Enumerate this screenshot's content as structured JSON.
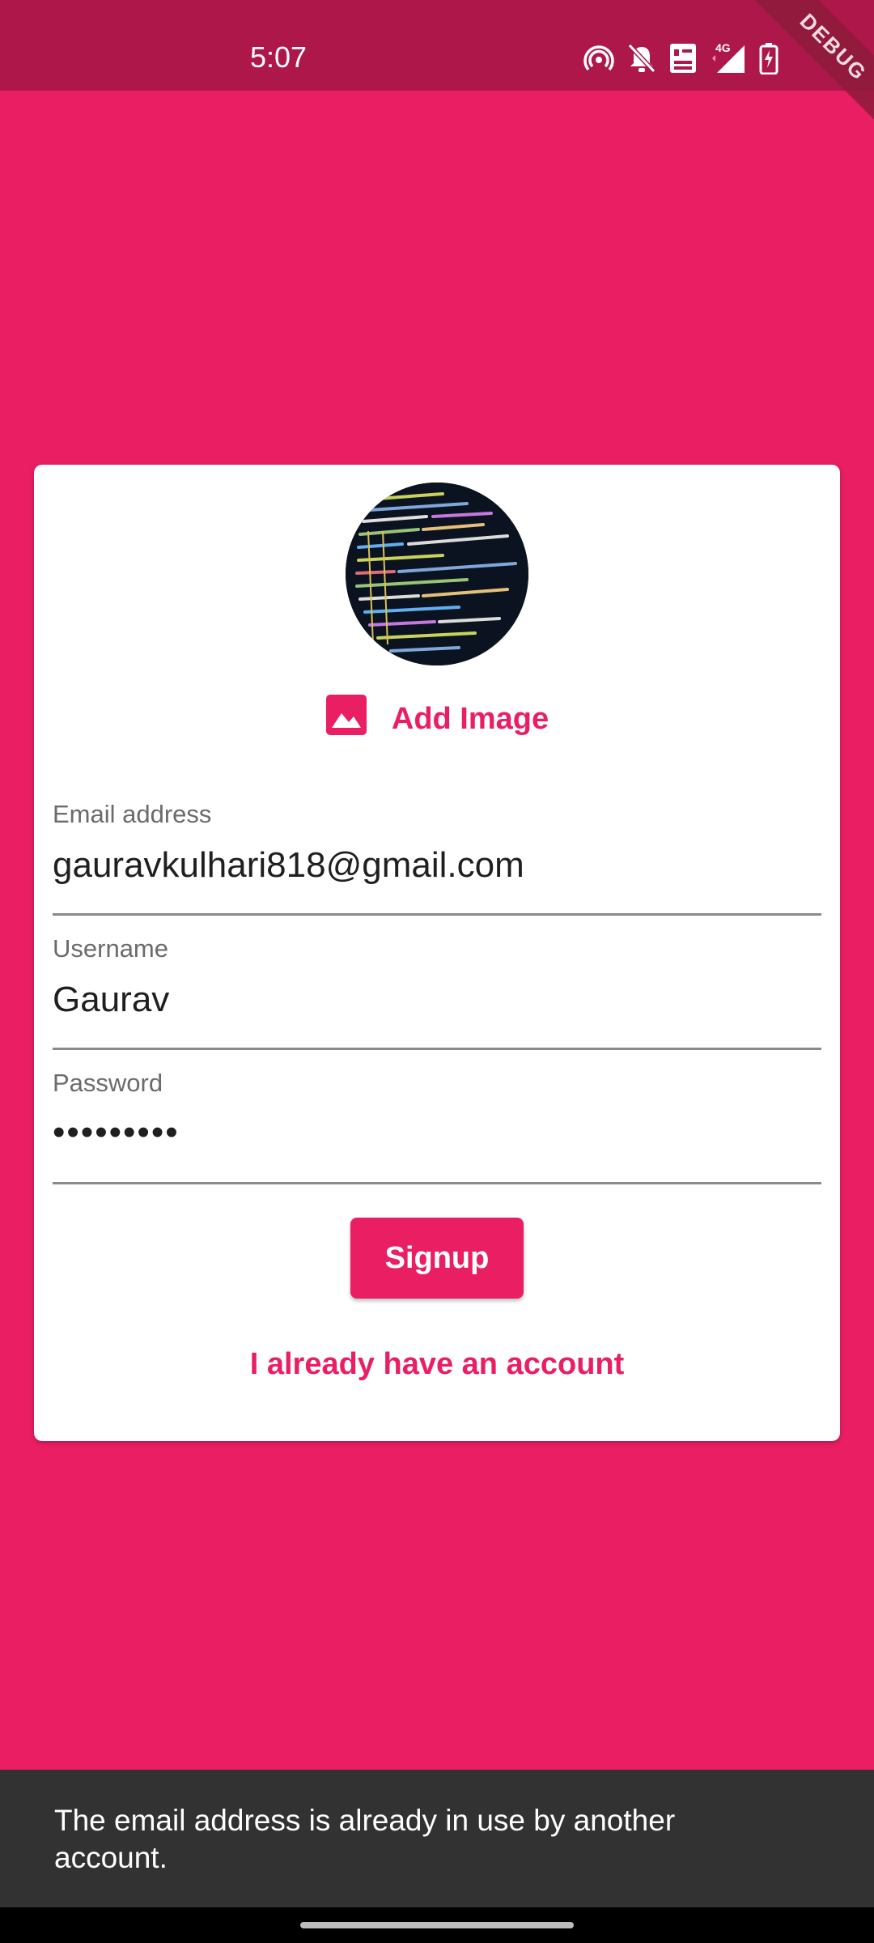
{
  "status_bar": {
    "time": "5:07",
    "network": "4G",
    "icons": [
      "hotspot-icon",
      "bell-off-icon",
      "volte-icon",
      "signal-icon",
      "battery-charging-icon"
    ]
  },
  "debug_banner": "DEBUG",
  "signup_form": {
    "add_image_label": "Add Image",
    "email": {
      "label": "Email address",
      "value": "gauravkulhari818@gmail.com"
    },
    "username": {
      "label": "Username",
      "value": "Gaurav"
    },
    "password": {
      "label": "Password",
      "value": "•••••••••"
    },
    "signup_label": "Signup",
    "login_link_label": "I already have an account"
  },
  "snackbar": {
    "message": "The email address is already in use by another account."
  },
  "colors": {
    "primary": "#E91E63",
    "status_bar": "#AD1749",
    "snackbar": "#323232"
  }
}
